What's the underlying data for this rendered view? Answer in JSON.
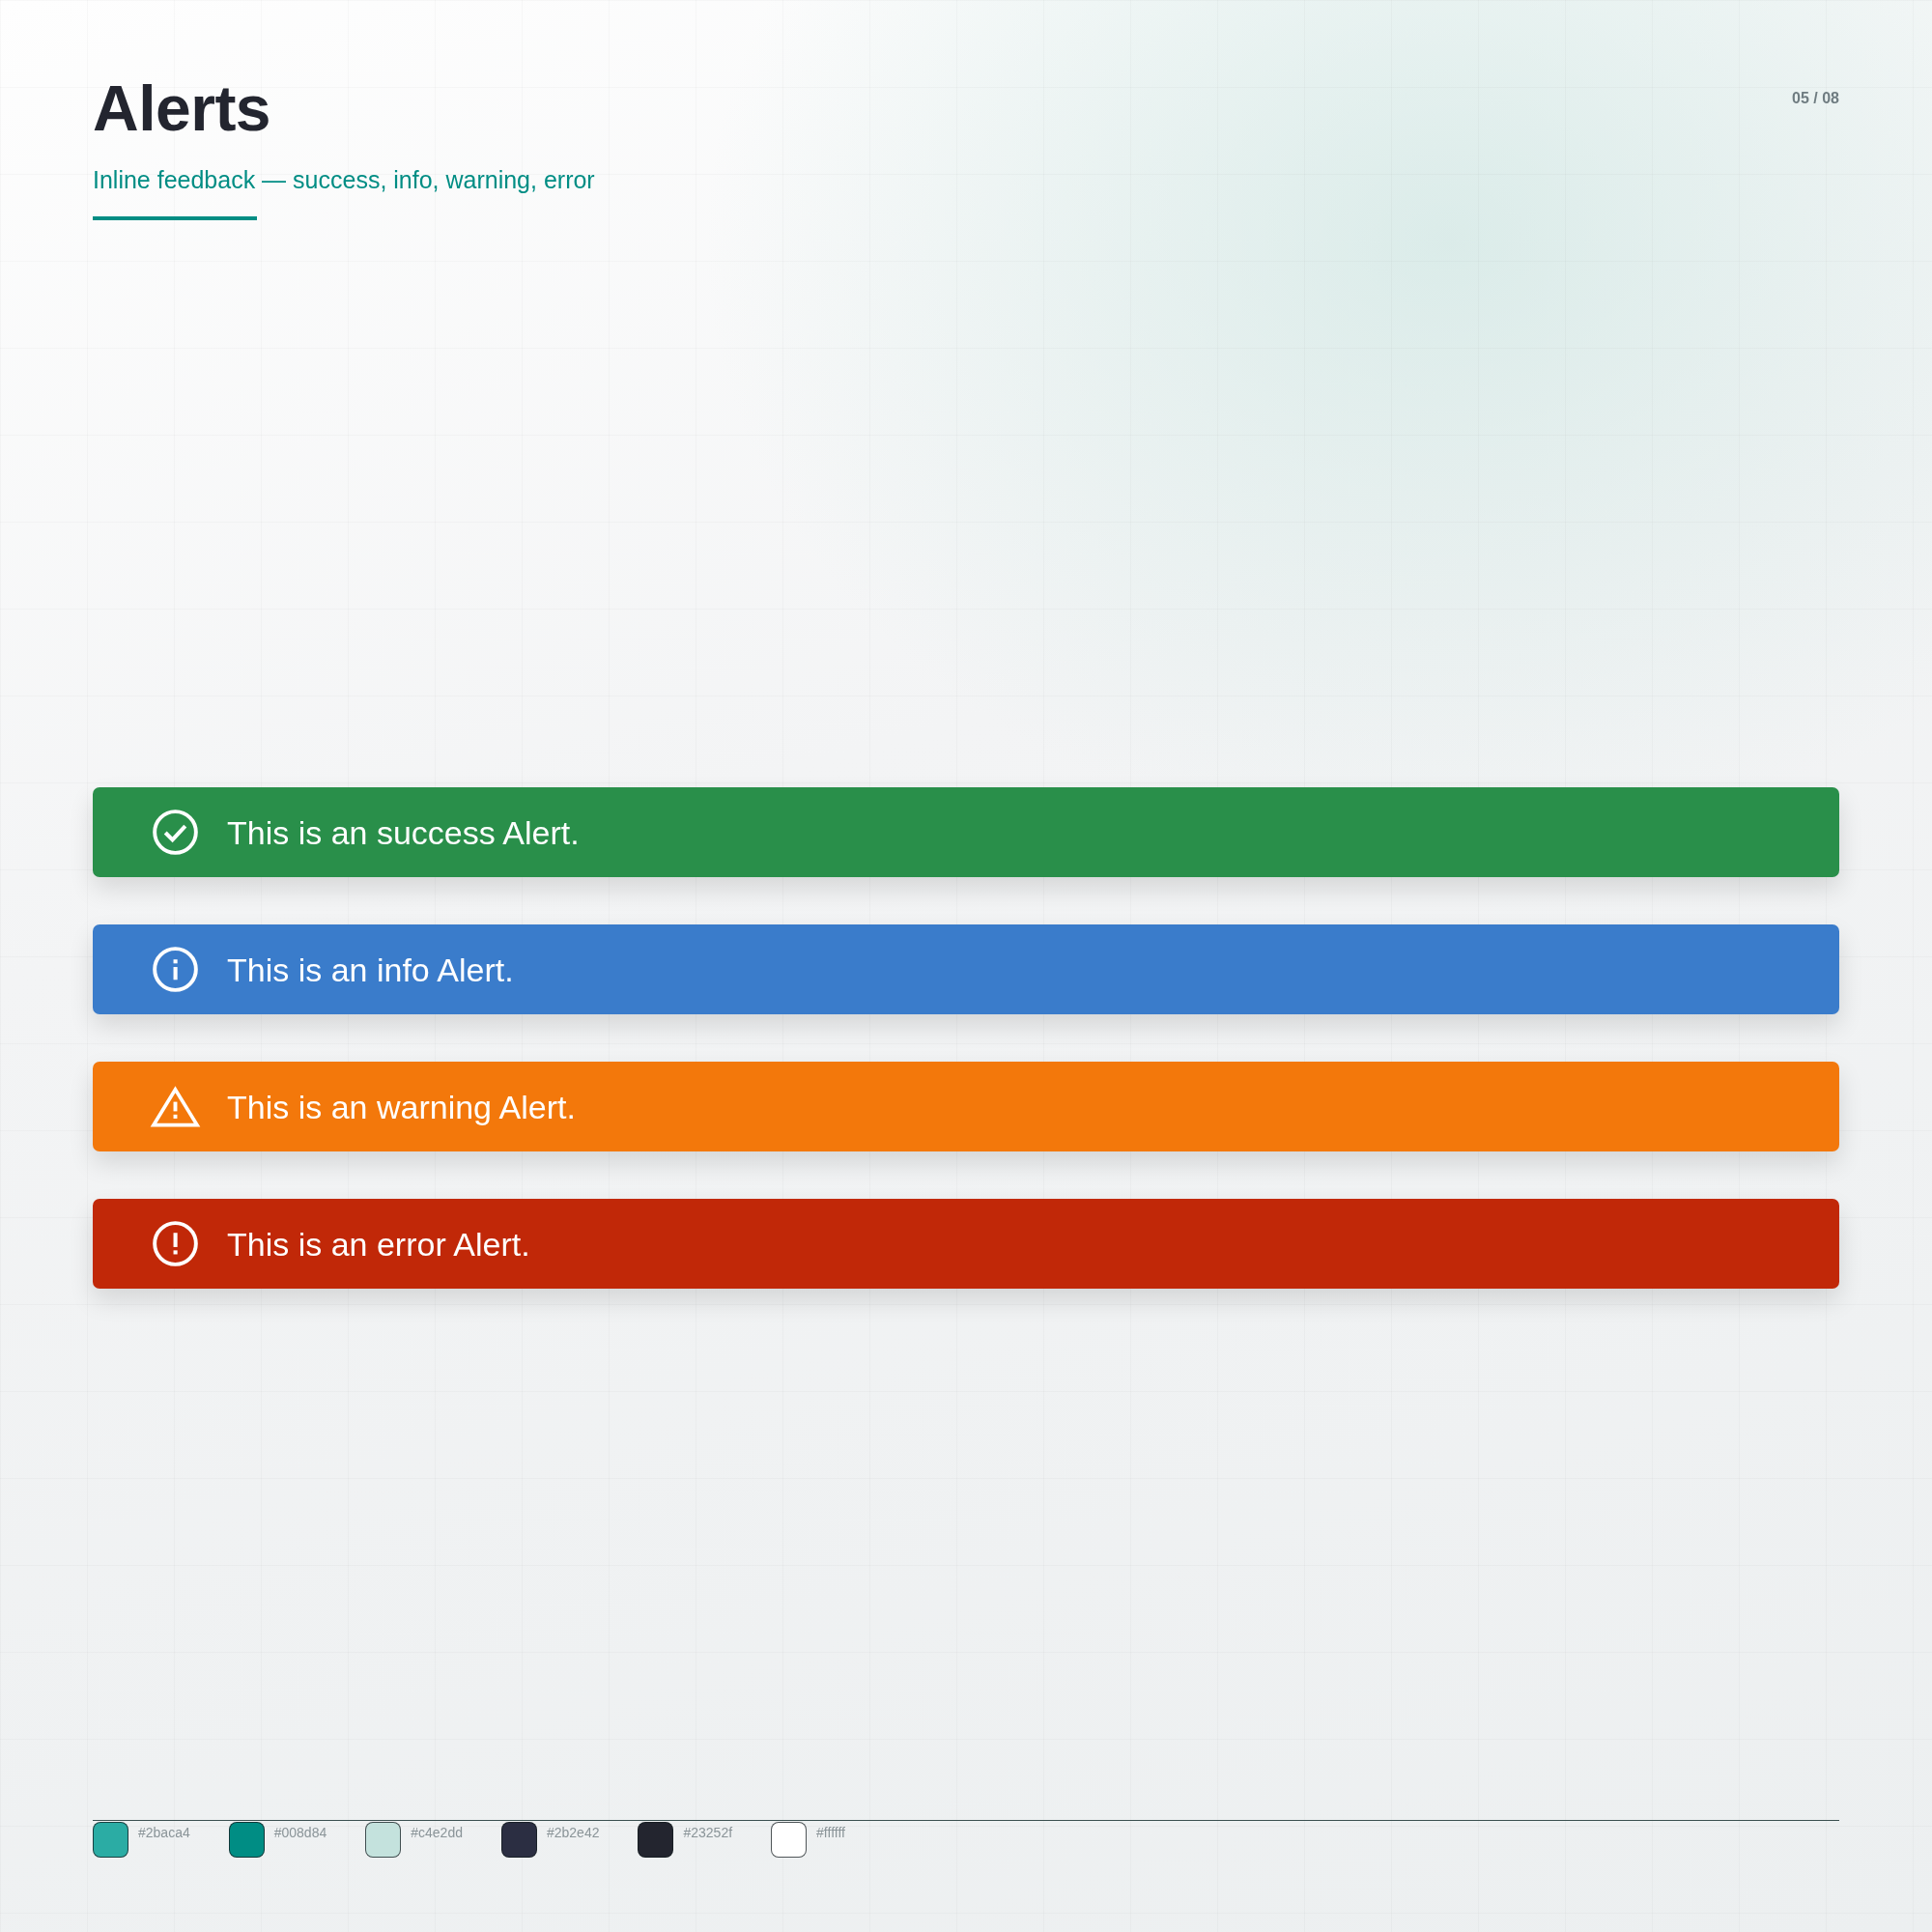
{
  "header": {
    "title": "Alerts",
    "subtitle": "Inline feedback — success, info, warning, error",
    "page": "05 / 08"
  },
  "alerts": [
    {
      "kind": "success",
      "text": "This is an success Alert.",
      "color": "#298f4a"
    },
    {
      "kind": "info",
      "text": "This is an info Alert.",
      "color": "#3a7ccb"
    },
    {
      "kind": "warning",
      "text": "This is an warning Alert.",
      "color": "#f3780b"
    },
    {
      "kind": "error",
      "text": "This is an error Alert.",
      "color": "#c12808"
    }
  ],
  "palette": [
    {
      "color": "#2baca4",
      "label": "#2baca4"
    },
    {
      "color": "#008d84",
      "label": "#008d84"
    },
    {
      "color": "#c4e2dd",
      "label": "#c4e2dd"
    },
    {
      "color": "#2b2e42",
      "label": "#2b2e42"
    },
    {
      "color": "#23252f",
      "label": "#23252f"
    },
    {
      "color": "#ffffff",
      "label": "#ffffff"
    }
  ]
}
